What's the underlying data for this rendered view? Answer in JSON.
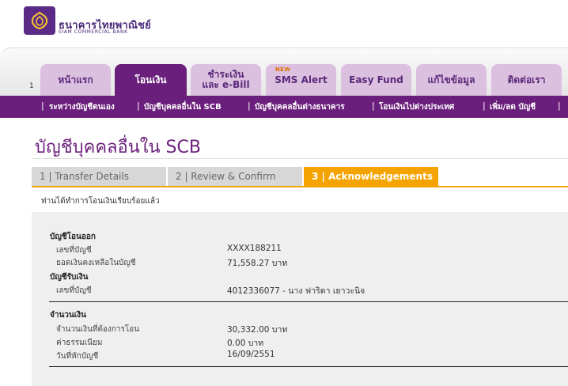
{
  "brand": {
    "name_th": "ธนาคารไทยพาณิชย์",
    "name_en": "SIAM COMMERCIAL BANK"
  },
  "nav": {
    "number": "1",
    "new_badge": "NEW",
    "tabs": [
      {
        "label": "หน้าแรก"
      },
      {
        "label": "โอนเงิน"
      },
      {
        "line1": "ชำระเงิน",
        "line2": "และ e-Bill"
      },
      {
        "label": "SMS Alert"
      },
      {
        "label": "Easy Fund"
      },
      {
        "label": "แก้ไขข้อมูล"
      },
      {
        "label": "ติดต่อเรา"
      }
    ],
    "sub_items": [
      {
        "label": "ระหว่างบัญชีตนเอง"
      },
      {
        "label": "บัญชีบุคคลอื่นใน SCB"
      },
      {
        "label": "บัญชีบุคคลอื่นต่างธนาคาร"
      },
      {
        "label": "โอนเงินไปต่างประเทศ"
      },
      {
        "label": "เพิ่ม/ลด บัญชี"
      }
    ]
  },
  "page": {
    "title": "บัญชีบุคคลอื่นใน SCB",
    "steps": [
      {
        "label": "1 | Transfer Details"
      },
      {
        "label": "2 | Review & Confirm"
      },
      {
        "label": "3 | Acknowledgements"
      }
    ],
    "confirmation": "ท่านได้ทำการโอนเงินเรียบร้อยแล้ว"
  },
  "details": {
    "from": {
      "title": "บัญชีโอนออก",
      "account_label": "เลขที่บัญชี",
      "account_value": "XXXX188211",
      "balance_label": "ยอดเงินคงเหลือในบัญชี",
      "balance_value": "71,558.27 บาท"
    },
    "to": {
      "title": "บัญชีรับเงิน",
      "account_label": "เลขที่บัญชี",
      "account_value": "4012336077 - นาง ฟาริดา เยาวะนิจ"
    },
    "amount": {
      "title": "จำนวนเงิน",
      "transfer_label": "จำนวนเงินที่ต้องการโอน",
      "transfer_value": "30,332.00 บาท",
      "fee_label": "ค่าธรรมเนียม",
      "fee_value": "0.00 บาท",
      "date_label": "วันที่หักบัญชี",
      "date_value": "16/09/2551"
    }
  },
  "colors": {
    "brand_purple": "#6b1f7c",
    "tab_inactive": "#dcc0e0",
    "step_active": "#f5a300",
    "step_inactive": "#d7d7d7",
    "panel_bg": "#efefef"
  }
}
